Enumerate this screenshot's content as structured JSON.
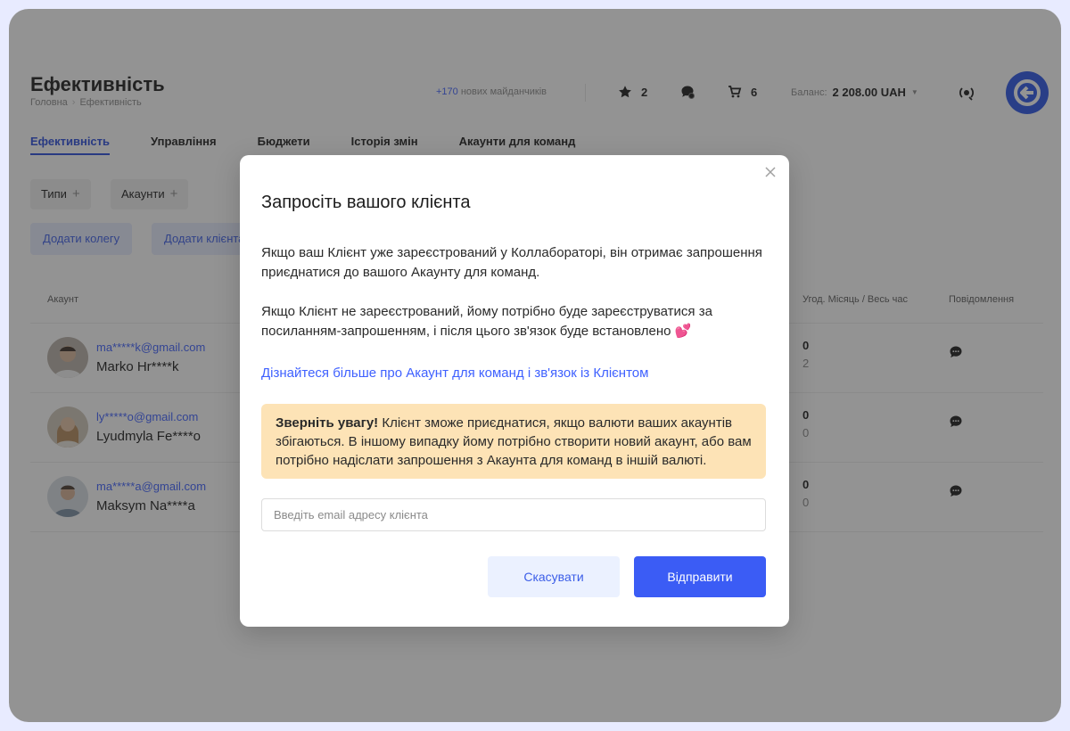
{
  "header": {
    "title": "Ефективність",
    "breadcrumb": [
      "Головна",
      "Ефективність"
    ],
    "new_sites_count": "+170",
    "new_sites_label": "нових майданчиків",
    "favorites_count": "2",
    "chat_count": "",
    "cart_count": "6",
    "balance_label": "Баланс:",
    "balance_value": "2 208.00 UAH"
  },
  "tabs": [
    "Ефективність",
    "Управління",
    "Бюджети",
    "Історія змін",
    "Акаунти для команд"
  ],
  "filters": {
    "types_label": "Типи",
    "accounts_label": "Акаунти"
  },
  "actions": {
    "add_colleague": "Додати колегу",
    "add_client": "Додати клієнта"
  },
  "table": {
    "col_account": "Акаунт",
    "col_deals": "Угод. Місяць / Весь час",
    "col_messages": "Повідомлення",
    "rows": [
      {
        "email": "ma*****k@gmail.com",
        "name": "Marko Hr****k",
        "month": "0",
        "all": "2"
      },
      {
        "email": "ly*****o@gmail.com",
        "name": "Lyudmyla Fe****o",
        "month": "0",
        "all": "0"
      },
      {
        "email": "ma*****a@gmail.com",
        "name": "Maksym Na****a",
        "month": "0",
        "all": "0"
      }
    ]
  },
  "modal": {
    "title": "Запросіть вашого клієнта",
    "para1": "Якщо ваш Клієнт уже зареєстрований у Коллабораторі, він отримає запрошення приєднатися до вашого Акаунту для команд.",
    "para2": "Якщо Клієнт не зареєстрований, йому потрібно буде зареєструватися за посиланням-запрошенням, і після цього зв'язок буде встановлено 💕",
    "link": "Дізнайтеся більше про Акаунт для команд і зв'язок із Клієнтом",
    "notice_bold": "Зверніть увагу!",
    "notice_text": " Клієнт зможе приєднатися, якщо валюти ваших акаунтів збігаються. В іншому випадку йому потрібно створити новий акаунт, або вам потрібно надіслати запрошення з Акаунта для команд в іншій валюті.",
    "email_placeholder": "Введіть email адресу клієнта",
    "cancel": "Скасувати",
    "send": "Відправити"
  },
  "colors": {
    "accent": "#3b5cf5",
    "link": "#3f61ff",
    "notice_bg": "#fde3b6",
    "page_bg": "#e8ebff"
  }
}
